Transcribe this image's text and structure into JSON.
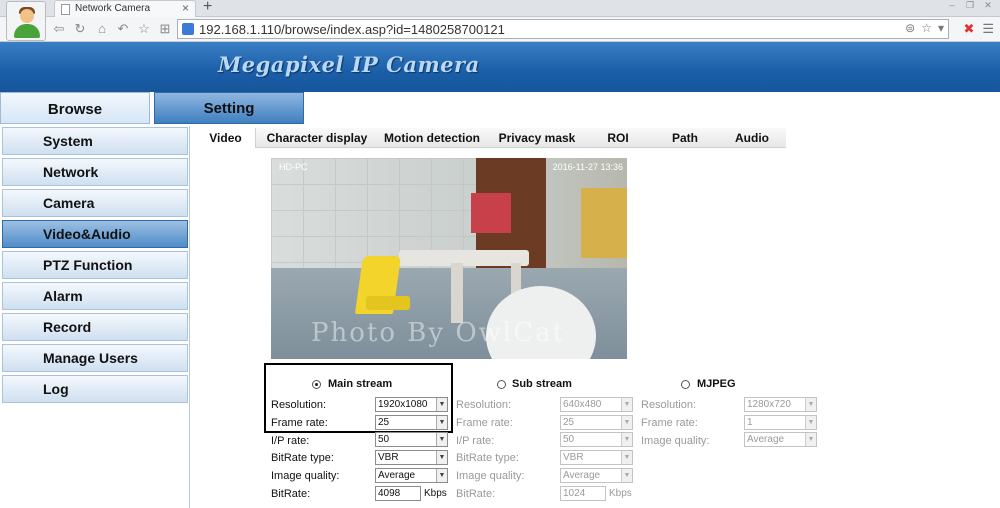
{
  "browser": {
    "tab_title": "Network Camera",
    "new_tab": "+",
    "url": "192.168.1.110/browse/index.asp?id=1480258700121"
  },
  "banner": {
    "title": "Megapixel IP Camera"
  },
  "topnav": {
    "browse": "Browse",
    "setting": "Setting"
  },
  "sidebar": {
    "items": [
      "System",
      "Network",
      "Camera",
      "Video&Audio",
      "PTZ Function",
      "Alarm",
      "Record",
      "Manage Users",
      "Log"
    ],
    "active": "Video&Audio"
  },
  "subtabs": [
    "Video",
    "Character display",
    "Motion detection",
    "Privacy mask",
    "ROI",
    "Path",
    "Audio"
  ],
  "video": {
    "osd_left": "HD-PC",
    "osd_right": "2016-11-27 13:36",
    "watermark": "Photo By OwlCat"
  },
  "main_stream": {
    "title": "Main stream",
    "selected": true,
    "resolution_label": "Resolution:",
    "resolution": "1920x1080",
    "frame_rate_label": "Frame rate:",
    "frame_rate": "25",
    "ip_rate_label": "I/P rate:",
    "ip_rate": "50",
    "bitrate_type_label": "BitRate type:",
    "bitrate_type": "VBR",
    "image_quality_label": "Image quality:",
    "image_quality": "Average",
    "bitrate_label": "BitRate:",
    "bitrate": "4098",
    "bitrate_unit": "Kbps"
  },
  "sub_stream": {
    "title": "Sub stream",
    "selected": false,
    "resolution_label": "Resolution:",
    "resolution": "640x480",
    "frame_rate_label": "Frame rate:",
    "frame_rate": "25",
    "ip_rate_label": "I/P rate:",
    "ip_rate": "50",
    "bitrate_type_label": "BitRate type:",
    "bitrate_type": "VBR",
    "image_quality_label": "Image quality:",
    "image_quality": "Average",
    "bitrate_label": "BitRate:",
    "bitrate": "1024",
    "bitrate_unit": "Kbps"
  },
  "mjpeg": {
    "title": "MJPEG",
    "selected": false,
    "resolution_label": "Resolution:",
    "resolution": "1280x720",
    "frame_rate_label": "Frame rate:",
    "frame_rate": "1",
    "image_quality_label": "Image quality:",
    "image_quality": "Average"
  }
}
